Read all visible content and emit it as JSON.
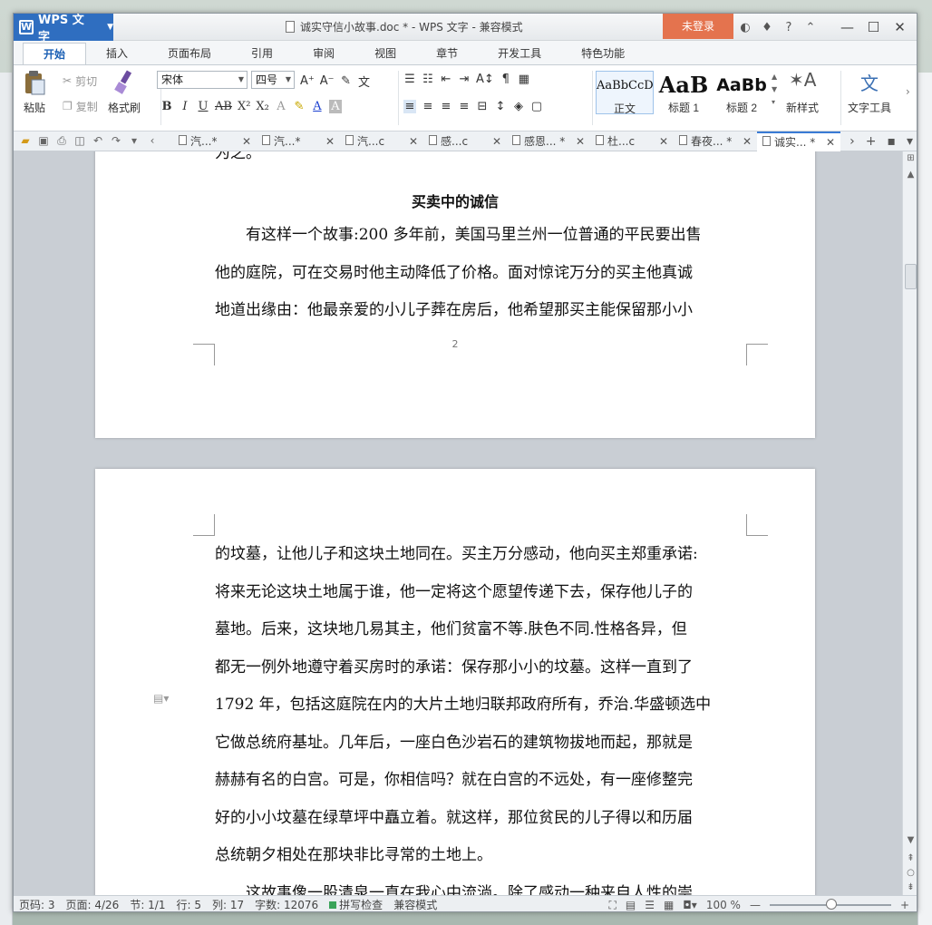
{
  "window": {
    "app_label": "WPS 文字",
    "title": "诚实守信小故事.doc * - WPS 文字 - 兼容模式",
    "login_label": "未登录"
  },
  "menu_tabs": [
    "开始",
    "插入",
    "页面布局",
    "引用",
    "审阅",
    "视图",
    "章节",
    "开发工具",
    "特色功能"
  ],
  "ribbon": {
    "paste": "粘贴",
    "cut": "剪切",
    "copy": "复制",
    "format_painter": "格式刷",
    "font_name": "宋体",
    "font_size": "四号",
    "styles": [
      {
        "sample": "AaBbCcD",
        "caption": "正文"
      },
      {
        "sample": "AaB",
        "caption": "标题 1"
      },
      {
        "sample": "AaBb",
        "caption": "标题 2"
      }
    ],
    "new_style": "新样式",
    "text_tools": "文字工具"
  },
  "doc_tabs": [
    {
      "label": "汽...*",
      "active": false
    },
    {
      "label": "汽...*",
      "active": false
    },
    {
      "label": "汽...c",
      "active": false
    },
    {
      "label": "感...c",
      "active": false
    },
    {
      "label": "感恩... *",
      "active": false
    },
    {
      "label": "杜...c",
      "active": false
    },
    {
      "label": "春夜... *",
      "active": false
    },
    {
      "label": "诚实... *",
      "active": true
    }
  ],
  "document": {
    "page1_top_fragment": "为之。",
    "heading": "买卖中的诚信",
    "page1_lines": [
      "有这样一个故事:200 多年前，美国马里兰州一位普通的平民要出售",
      "他的庭院，可在交易时他主动降低了价格。面对惊诧万分的买主他真诚",
      "地道出缘由：他最亲爱的小儿子葬在房后，他希望那买主能保留那小小"
    ],
    "page_number": "2",
    "page2_lines": [
      "的坟墓，让他儿子和这块土地同在。买主万分感动，他向买主郑重承诺:",
      "将来无论这块土地属于谁，他一定将这个愿望传递下去，保存他儿子的",
      "墓地。后来，这块地几易其主，他们贫富不等.肤色不同.性格各异，但",
      "都无一例外地遵守着买房时的承诺：保存那小小的坟墓。这样一直到了",
      "1792 年，包括这庭院在内的大片土地归联邦政府所有，乔治.华盛顿选中",
      "它做总统府基址。几年后，一座白色沙岩石的建筑物拔地而起，那就是",
      "赫赫有名的白宫。可是，你相信吗？就在白宫的不远处，有一座修整完",
      "好的小小坟墓在绿草坪中矗立着。就这样，那位贫民的儿子得以和历届",
      "总统朝夕相处在那块非比寻常的土地上。",
      "这故事像一股清泉一直在我心中流淌。除了感动一种来自人性的崇"
    ]
  },
  "status": {
    "page_code": "页码: 3",
    "page": "页面: 4/26",
    "section": "节: 1/1",
    "row": "行: 5",
    "col": "列: 17",
    "word_count": "字数: 12076",
    "spellcheck": "拼写检查",
    "compat": "兼容模式",
    "zoom": "100 %"
  },
  "colors": {
    "accent": "#2f6ec0",
    "login": "#e4734e"
  }
}
